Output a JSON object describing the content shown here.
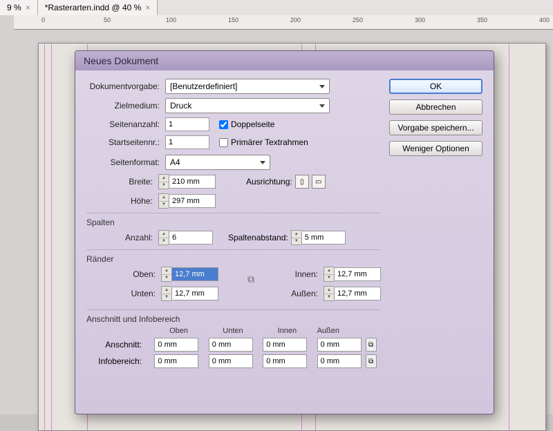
{
  "tabs": {
    "t1": "9 %",
    "t1x": "×",
    "t2": "*Rasterarten.indd @ 40 %",
    "t2x": "×"
  },
  "ruler": {
    "r0": "0",
    "r50": "50",
    "r100": "100",
    "r150": "150",
    "r200": "200",
    "r250": "250",
    "r300": "300",
    "r350": "350",
    "r400": "400"
  },
  "dialog": {
    "title": "Neues Dokument",
    "preset_lbl": "Dokumentvorgabe:",
    "preset_val": "[Benutzerdefiniert]",
    "intent_lbl": "Zielmedium:",
    "intent_val": "Druck",
    "pages_lbl": "Seitenanzahl:",
    "pages_val": "1",
    "facing_lbl": "Doppelseite",
    "start_lbl": "Startseitennr.:",
    "start_val": "1",
    "frame_lbl": "Primärer Textrahmen",
    "size_lbl": "Seitenformat:",
    "size_val": "A4",
    "width_lbl": "Breite:",
    "width_val": "210 mm",
    "height_lbl": "Höhe:",
    "height_val": "297 mm",
    "orient_lbl": "Ausrichtung:",
    "cols_title": "Spalten",
    "cols_lbl": "Anzahl:",
    "cols_val": "6",
    "gutter_lbl": "Spaltenabstand:",
    "gutter_val": "5 mm",
    "marg_title": "Ränder",
    "m_top_lbl": "Oben:",
    "m_top_val": "12,7 mm",
    "m_bot_lbl": "Unten:",
    "m_bot_val": "12,7 mm",
    "m_in_lbl": "Innen:",
    "m_in_val": "12,7 mm",
    "m_out_lbl": "Außen:",
    "m_out_val": "12,7 mm",
    "bleed_title": "Anschnitt und Infobereich",
    "h_top": "Oben",
    "h_bot": "Unten",
    "h_in": "Innen",
    "h_out": "Außen",
    "bleed_lbl": "Anschnitt:",
    "bleed_val": "0 mm",
    "slug_lbl": "Infobereich:",
    "slug_val": "0 mm",
    "ok": "OK",
    "cancel": "Abbrechen",
    "save": "Vorgabe speichern...",
    "less": "Weniger Optionen"
  }
}
